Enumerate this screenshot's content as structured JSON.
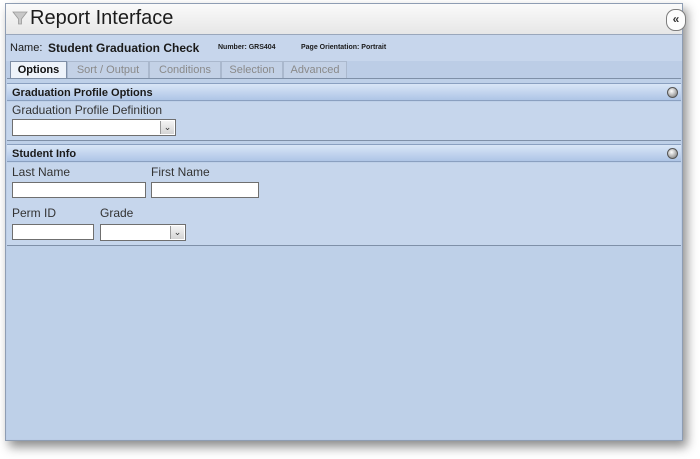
{
  "window": {
    "title": "Report Interface",
    "collapse_icon": "double-chevron-left-icon"
  },
  "report": {
    "name_label": "Name:",
    "name_value": "Student Graduation Check",
    "number_label": "Number: GRS404",
    "orientation_label": "Page Orientation: Portrait"
  },
  "tabs": [
    {
      "label": "Options",
      "active": true
    },
    {
      "label": "Sort / Output",
      "active": false
    },
    {
      "label": "Conditions",
      "active": false
    },
    {
      "label": "Selection",
      "active": false
    },
    {
      "label": "Advanced",
      "active": false
    }
  ],
  "sections": {
    "graduation": {
      "title": "Graduation Profile Options",
      "definition_label": "Graduation Profile Definition",
      "definition_value": ""
    },
    "student": {
      "title": "Student Info",
      "last_name_label": "Last Name",
      "last_name_value": "",
      "first_name_label": "First Name",
      "first_name_value": "",
      "perm_id_label": "Perm ID",
      "perm_id_value": "",
      "grade_label": "Grade",
      "grade_value": ""
    }
  },
  "colors": {
    "background": "#bccde6",
    "section_header": "#aec5e6",
    "titlebar": "#f0f0f0"
  }
}
